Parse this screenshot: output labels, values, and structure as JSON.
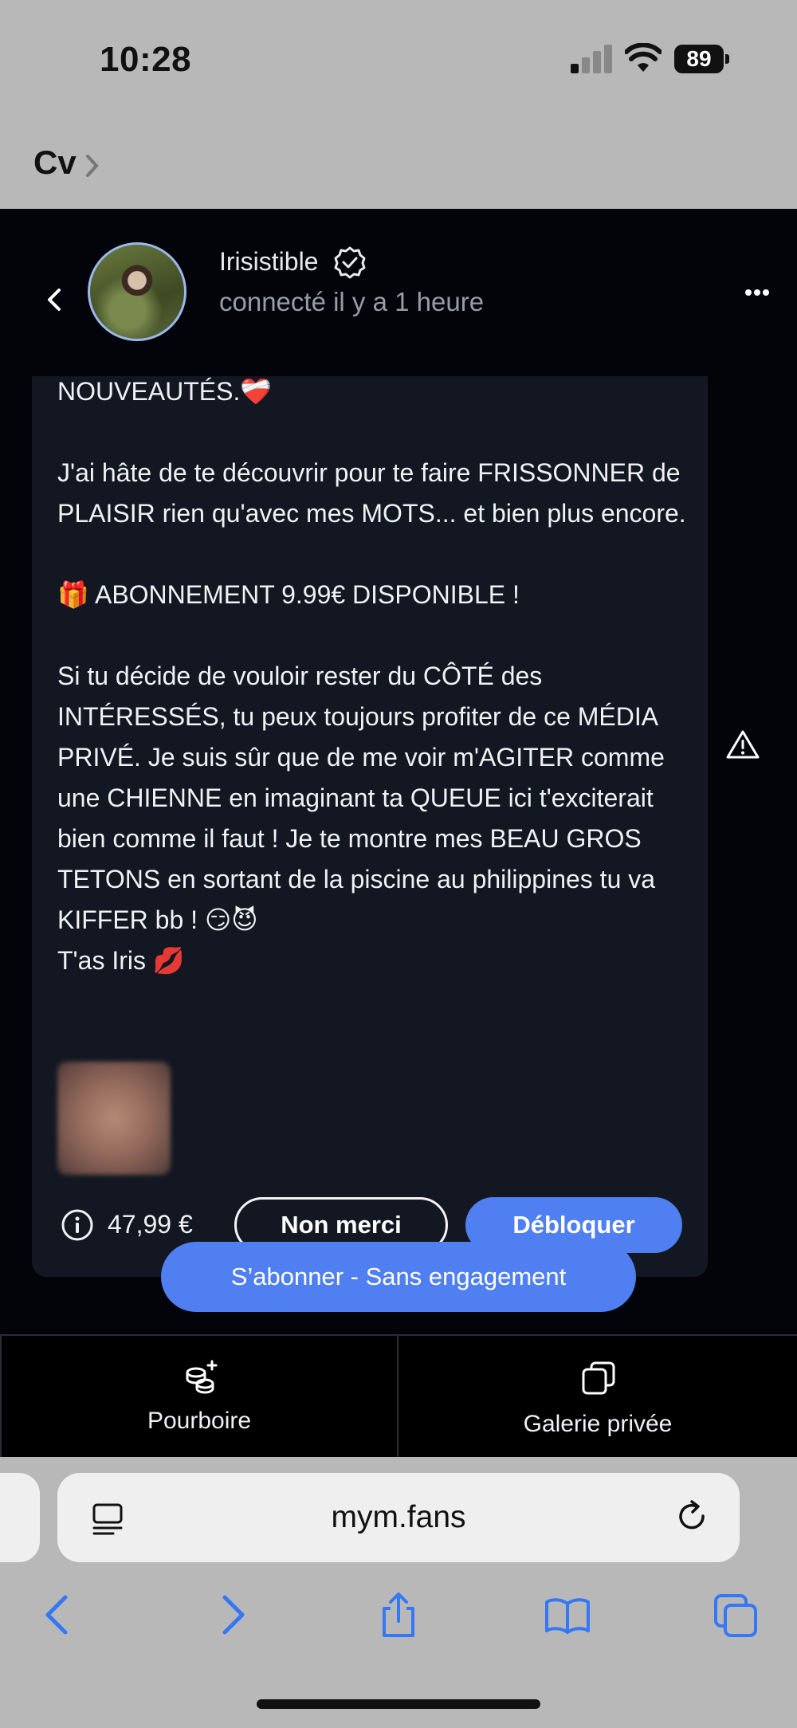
{
  "status_bar": {
    "time": "10:28",
    "battery": "89"
  },
  "breadcrumb": {
    "label": "Cv"
  },
  "chat": {
    "creator_name": "Irisistible",
    "presence": "connecté il y a 1 heure"
  },
  "message": {
    "text": "NOUVEAUTÉS.❤️‍🩹\n\nJ'ai hâte de te découvrir pour te faire FRISSONNER de PLAISIR rien qu'avec mes MOTS... et bien plus encore.\n\n🎁 ABONNEMENT 9.99€ DISPONIBLE !\n\nSi tu décide de vouloir rester du CÔTÉ des INTÉRESSÉS, tu peux toujours profiter de ce MÉDIA PRIVÉ. Je suis sûr que de me voir m'AGITER comme une CHIENNE en imaginant ta QUEUE ici t'exciterait bien comme il faut ! Je te montre mes BEAU GROS TETONS en sortant de la piscine au philippines tu va KIFFER bb ! 😏😈\nT'as Iris 💋",
    "price": "47,99 €",
    "decline_label": "Non merci",
    "unlock_label": "Débloquer"
  },
  "subscribe_label": "S’abonner - Sans engagement",
  "tabs": [
    {
      "label": "Pourboire",
      "icon": "coins-plus-icon"
    },
    {
      "label": "Galerie privée",
      "icon": "gallery-copy-icon"
    }
  ],
  "browser": {
    "url": "mym.fans"
  },
  "colors": {
    "accent": "#4f7ff0",
    "background": "#02040a",
    "card": "#121722"
  }
}
